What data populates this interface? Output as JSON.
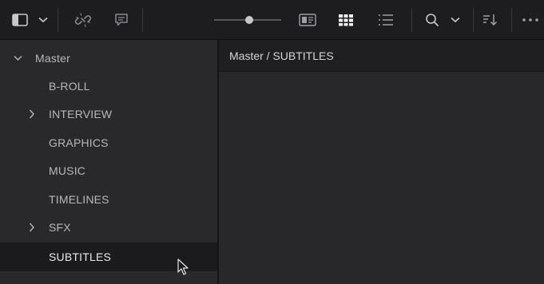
{
  "toolbar": {
    "icons": [
      "sidebar-toggle-icon",
      "chevron-down-icon",
      "unlink-icon",
      "subtitle-icon",
      "zoom-slider",
      "metadata-view-icon",
      "thumbnail-view-icon",
      "list-view-icon",
      "search-icon",
      "chevron-down-icon",
      "sort-icon",
      "more-icon"
    ],
    "zoom_level": 0.6
  },
  "sidebar": {
    "root": {
      "label": "Master",
      "expanded": true
    },
    "items": [
      {
        "label": "B-ROLL",
        "has_children": false
      },
      {
        "label": "INTERVIEW",
        "has_children": true
      },
      {
        "label": "GRAPHICS",
        "has_children": false
      },
      {
        "label": "MUSIC",
        "has_children": false
      },
      {
        "label": "TIMELINES",
        "has_children": false
      },
      {
        "label": "SFX",
        "has_children": true
      },
      {
        "label": "SUBTITLES",
        "has_children": false,
        "selected": true
      }
    ]
  },
  "main": {
    "breadcrumb": "Master / SUBTITLES"
  },
  "colors": {
    "toolbar_bg": "#1d1d20",
    "sidebar_bg": "#29292c",
    "selected_bg": "#1b1b1d",
    "text": "#b8b8bc"
  }
}
